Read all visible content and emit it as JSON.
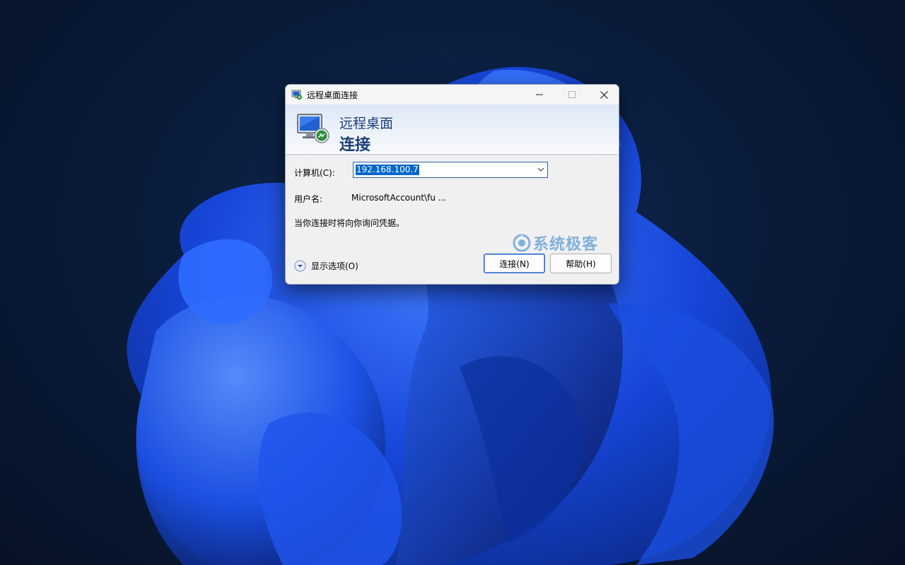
{
  "window": {
    "title": "远程桌面连接",
    "controls": {
      "minimize": "—",
      "maximize": "☐",
      "close": "✕"
    },
    "app_icon": "remote-desktop-icon"
  },
  "banner": {
    "line1": "远程桌面",
    "line2": "连接",
    "icon": "monitor-remote-icon"
  },
  "form": {
    "computer_label": "计算机(C):",
    "computer_value": "192.168.100.7",
    "user_label": "用户名:",
    "user_value": "MicrosoftAccount\\fu ...",
    "info": "当你连接时将向你询问凭据。"
  },
  "footer": {
    "show_options": "显示选项(O)",
    "connect_button": "连接(N)",
    "help_button": "帮助(H)"
  },
  "watermark": "系统极客",
  "colors": {
    "accent": "#2b63c6",
    "banner_text": "#1d3f7a",
    "selection": "#0066cc",
    "watermark": "#5b9bd5"
  }
}
